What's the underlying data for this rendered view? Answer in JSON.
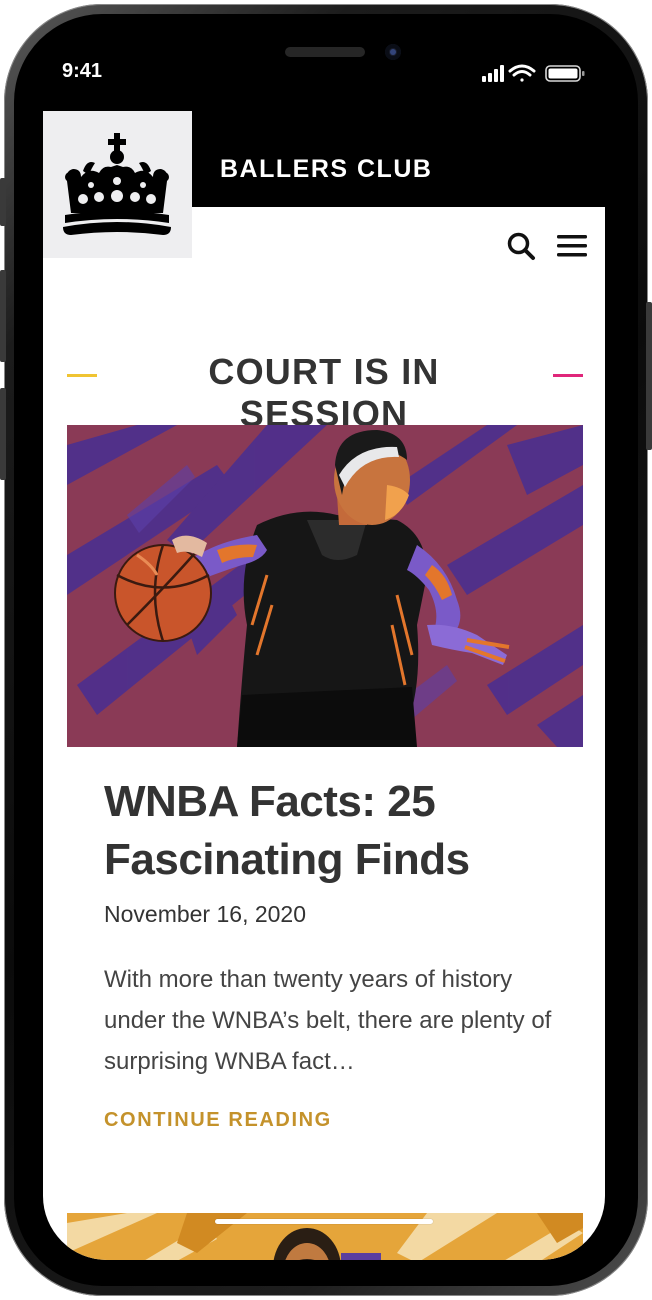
{
  "status_bar": {
    "time": "9:41",
    "icons": [
      "cellular-signal-icon",
      "wifi-icon",
      "battery-icon"
    ]
  },
  "header": {
    "site_title": "BALLERS CLUB",
    "logo_icon": "crown-icon",
    "search_icon": "search-icon",
    "menu_icon": "hamburger-menu-icon"
  },
  "section": {
    "heading": "COURT IS IN SESSION",
    "left_dash_color": "#f0c432",
    "right_dash_color": "#e0267a"
  },
  "post": {
    "image_label": "basketball-player-illustration",
    "title": "WNBA Facts: 25 Fascinating Finds",
    "date": "November 16, 2020",
    "excerpt": "With more than twenty years of history under the WNBA’s belt, there are plenty of surprising WNBA fact…",
    "continue_label": "CONTINUE READING"
  },
  "colors": {
    "header_bg": "#000000",
    "accent_gold": "#c4922b",
    "text_dark": "#333333",
    "image_bg_purple": "#8a3a56",
    "next_image_bg": "#e5a53a"
  }
}
